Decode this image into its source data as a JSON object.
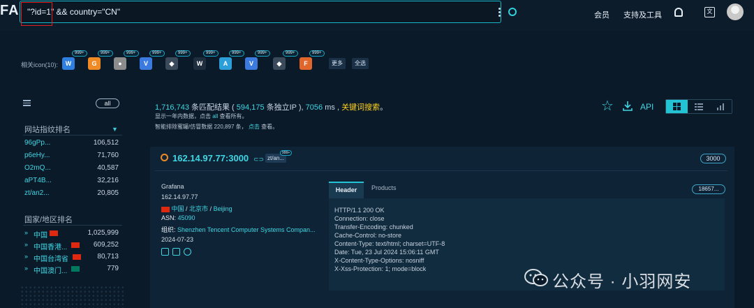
{
  "app": {
    "logo": "FA"
  },
  "search": {
    "query": "\"?id=1\" && country=\"CN\""
  },
  "nav": {
    "member": "会员",
    "support": "支持及工具"
  },
  "icons_strip": {
    "label": "相关icon(10):",
    "badge": "999+",
    "icons": [
      {
        "name": "w-blue",
        "glyph": "W",
        "color": "#2f7fe0"
      },
      {
        "name": "grafana",
        "glyph": "G",
        "color": "#f08a24"
      },
      {
        "name": "round-grey",
        "glyph": "●",
        "color": "#8c8c8c"
      },
      {
        "name": "v-blue",
        "glyph": "V",
        "color": "#3b7be0"
      },
      {
        "name": "compass",
        "glyph": "◆",
        "color": "#3a4a5a"
      },
      {
        "name": "w-white",
        "glyph": "W",
        "color": "#1e2e3e"
      },
      {
        "name": "a-teal",
        "glyph": "A",
        "color": "#2c9ed8"
      },
      {
        "name": "v-blue-2",
        "glyph": "V",
        "color": "#3b7be0"
      },
      {
        "name": "compass-2",
        "glyph": "◆",
        "color": "#3a4a5a"
      },
      {
        "name": "fox",
        "glyph": "F",
        "color": "#e0662b"
      }
    ],
    "more": "更多",
    "select_all": "全选"
  },
  "sidebar": {
    "all_label": "all",
    "fingerprint_title": "网站指纹排名",
    "fingerprint_rows": [
      {
        "key": "96gPp...",
        "value": "106,512"
      },
      {
        "key": "p6eHy...",
        "value": "71,760"
      },
      {
        "key": "O2mQ...",
        "value": "40,587"
      },
      {
        "key": "aPT4B...",
        "value": "32,216"
      },
      {
        "key": "zt/an2...",
        "value": "20,805"
      }
    ],
    "country_title": "国家/地区排名",
    "country_rows": [
      {
        "name": "中国",
        "value": "1,025,999",
        "flag": "#de2910"
      },
      {
        "name": "中国香港...",
        "value": "609,252",
        "flag": "#de2910"
      },
      {
        "name": "中国台湾省",
        "value": "80,713",
        "flag": "#de2910"
      },
      {
        "name": "中国澳门...",
        "value": "779",
        "flag": "#00785e"
      }
    ]
  },
  "summary": {
    "count": "1,716,743",
    "match_text": "条匹配结果 (",
    "ip_count": "594,175",
    "ip_text": "条独立IP ),",
    "time": "7056",
    "time_unit": "ms ,",
    "keyword_search": "关键词搜索",
    "line2_a": "显示一年内数据，点击",
    "line2_link": "all",
    "line2_b": "查看所有。",
    "line3_a": "智能排除蜜罐/仿冒数据",
    "line3_num": "220,897",
    "line3_b": "条，",
    "line3_link": "点击",
    "line3_c": "查看。",
    "api": "API"
  },
  "result": {
    "ip_port": "162.14.97.77:3000",
    "tag": "zt/an...",
    "tag_badge": "999+",
    "port": "3000",
    "title": "Grafana",
    "ip": "162.14.97.77",
    "country": "中国",
    "city": "北京市",
    "city_en": "Beijing",
    "asn_label": "ASN:",
    "asn": "45090",
    "org_label": "组织:",
    "org": "Shenzhen Tencent Computer Systems Compan...",
    "date": "2024-07-23",
    "tab_header": "Header",
    "tab_products": "Products",
    "count_pill": "18657...",
    "headers": [
      "HTTP/1.1 200 OK",
      "Connection: close",
      "Transfer-Encoding: chunked",
      "Cache-Control: no-store",
      "Content-Type: text/html; charset=UTF-8",
      "Date: Tue, 23 Jul 2024 15:06:11 GMT",
      "X-Content-Type-Options: nosniff",
      "X-Xss-Protection: 1; mode=block"
    ]
  },
  "watermark": {
    "text": "公众号 · 小羽网安"
  }
}
